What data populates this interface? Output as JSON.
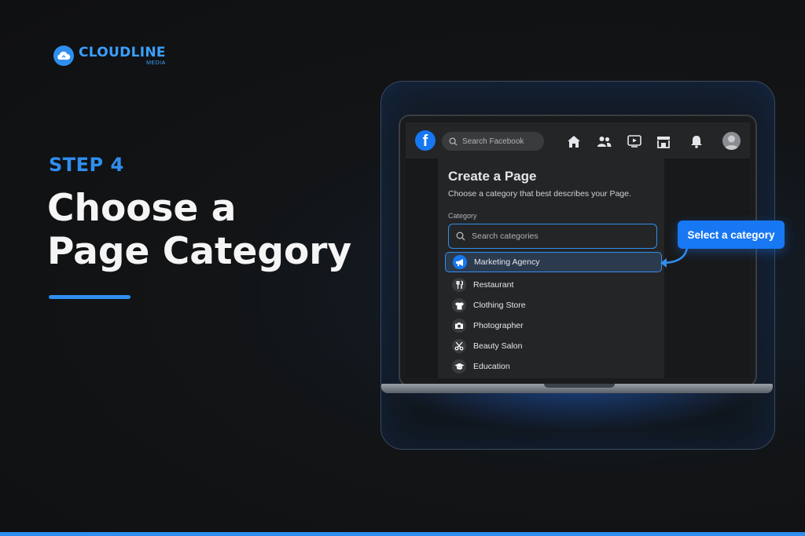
{
  "brand": {
    "name": "CLOUDLINE",
    "sub": "MEDIA"
  },
  "step_label": "STEP 4",
  "headline": {
    "line1": "Choose a",
    "line2": "Page Category"
  },
  "facebook": {
    "search_placeholder": "Search Facebook",
    "nav_icons": [
      "home-icon",
      "friends-icon",
      "watch-icon",
      "marketplace-icon",
      "notifications-icon"
    ]
  },
  "create_page": {
    "title": "Create a Page",
    "subtitle": "Choose a category that best describes your Page.",
    "field_label": "Category",
    "search_placeholder": "Search categories",
    "categories": [
      {
        "label": "Marketing Agency",
        "icon": "megaphone-icon",
        "selected": true
      },
      {
        "label": "Restaurant",
        "icon": "utensils-icon",
        "selected": false
      },
      {
        "label": "Clothing Store",
        "icon": "shirt-icon",
        "selected": false
      },
      {
        "label": "Photographer",
        "icon": "camera-icon",
        "selected": false
      },
      {
        "label": "Beauty Salon",
        "icon": "scissors-icon",
        "selected": false
      },
      {
        "label": "Education",
        "icon": "graduation-cap-icon",
        "selected": false
      }
    ]
  },
  "callout": "Select a category",
  "colors": {
    "accent": "#2f8ff0",
    "facebook_blue": "#1877f2",
    "background": "#121416"
  }
}
